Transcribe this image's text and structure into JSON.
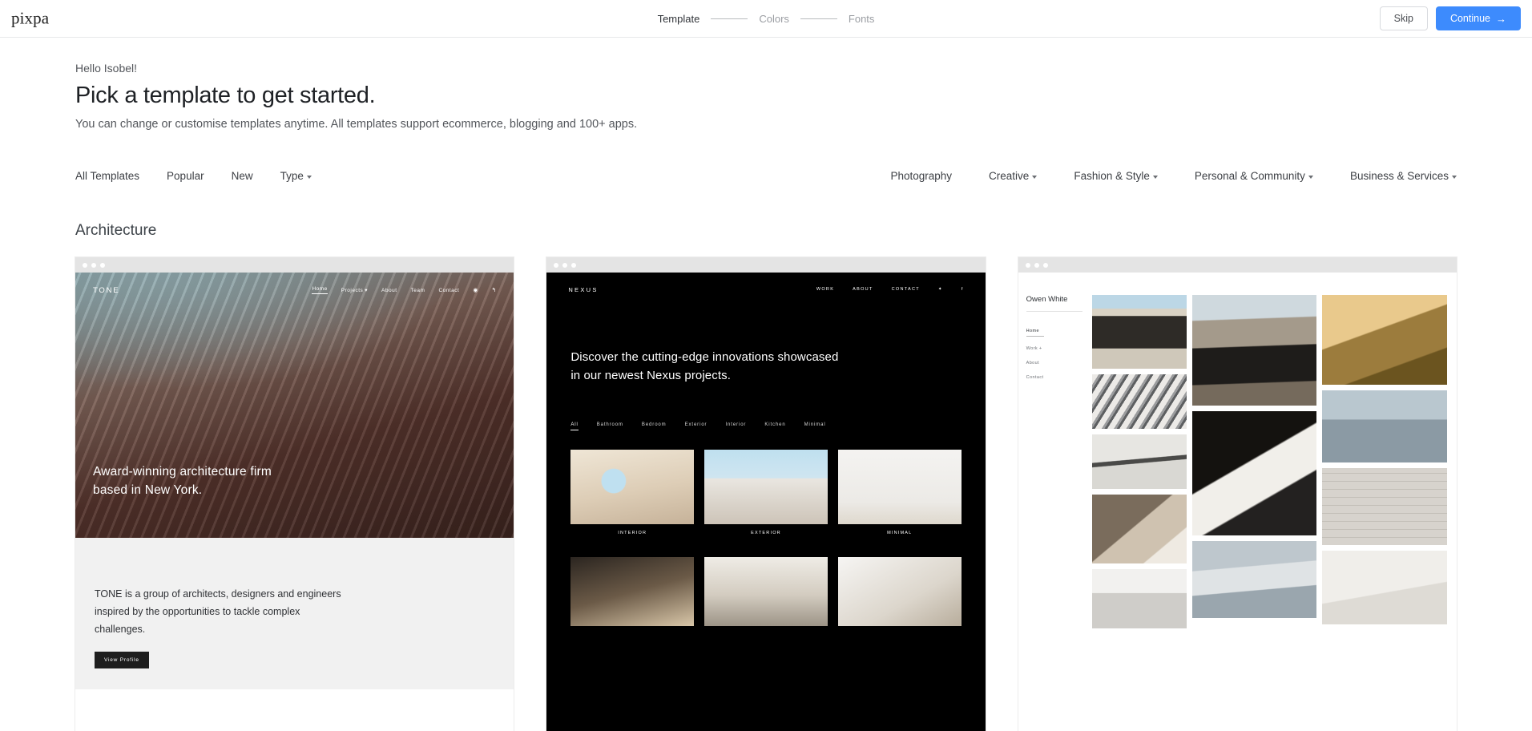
{
  "topbar": {
    "logo": "pixpa",
    "steps": [
      {
        "label": "Template",
        "active": true
      },
      {
        "label": "Colors",
        "active": false
      },
      {
        "label": "Fonts",
        "active": false
      }
    ],
    "skip_label": "Skip",
    "continue_label": "Continue",
    "continue_arrow": "→",
    "accent_color": "#3d8bfd"
  },
  "intro": {
    "greeting": "Hello Isobel!",
    "title": "Pick a template to get started.",
    "subtitle": "You can change or customise templates anytime. All templates support ecommerce, blogging and 100+ apps."
  },
  "filters": {
    "left": [
      {
        "label": "All Templates",
        "caret": false
      },
      {
        "label": "Popular",
        "caret": false
      },
      {
        "label": "New",
        "caret": false
      },
      {
        "label": "Type",
        "caret": true
      }
    ],
    "right": [
      {
        "label": "Photography",
        "caret": false
      },
      {
        "label": "Creative",
        "caret": true
      },
      {
        "label": "Fashion & Style",
        "caret": true
      },
      {
        "label": "Personal & Community",
        "caret": true
      },
      {
        "label": "Business & Services",
        "caret": true
      }
    ]
  },
  "section": {
    "title": "Architecture"
  },
  "templates": [
    {
      "id": "tone",
      "brand": "TONE",
      "nav": [
        {
          "label": "Home",
          "active": true,
          "caret": false
        },
        {
          "label": "Projects",
          "active": false,
          "caret": true
        },
        {
          "label": "About",
          "active": false,
          "caret": false
        },
        {
          "label": "Team",
          "active": false,
          "caret": false
        },
        {
          "label": "Contact",
          "active": false,
          "caret": false
        }
      ],
      "icons": [
        "instagram-icon",
        "share-icon"
      ],
      "hero": "Award-winning architecture firm based in New York.",
      "body": "TONE is a group of architects, designers and engineers inspired by the opportunities to tackle complex challenges.",
      "cta": "View Profile"
    },
    {
      "id": "nexus",
      "brand": "NEXUS",
      "nav": [
        {
          "label": "WORK"
        },
        {
          "label": "ABOUT"
        },
        {
          "label": "CONTACT"
        }
      ],
      "icons": [
        "twitter-icon",
        "facebook-icon"
      ],
      "hero": "Discover the cutting-edge innovations showcased in our newest Nexus projects.",
      "gallery_filters": [
        {
          "label": "All",
          "active": true
        },
        {
          "label": "Bathroom",
          "active": false
        },
        {
          "label": "Bedroom",
          "active": false
        },
        {
          "label": "Exterior",
          "active": false
        },
        {
          "label": "Interior",
          "active": false
        },
        {
          "label": "Kitchen",
          "active": false
        },
        {
          "label": "Minimal",
          "active": false
        }
      ],
      "thumb_captions": [
        "INTERIOR",
        "EXTERIOR",
        "MINIMAL"
      ]
    },
    {
      "id": "owen-white",
      "brand": "Owen White",
      "nav": [
        {
          "label": "Home",
          "active": true
        },
        {
          "label": "Work +",
          "active": false
        },
        {
          "label": "About",
          "active": false
        },
        {
          "label": "Contact",
          "active": false
        }
      ]
    }
  ]
}
